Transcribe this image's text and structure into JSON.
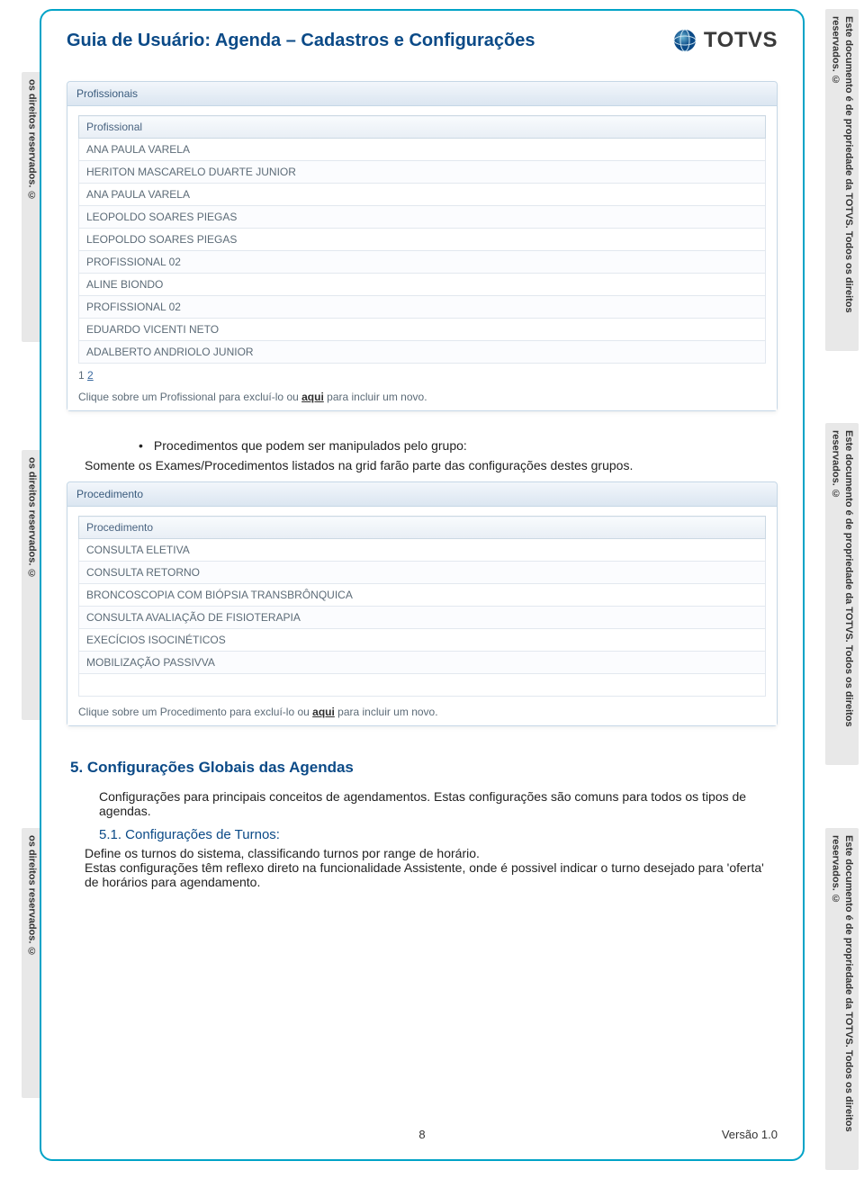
{
  "doc_title": "Guia de Usuário: Agenda – Cadastros e Configurações",
  "brand": "TOTVS",
  "watermark": "Este documento é de propriedade da TOTVS. Todos os direitos reservados. ©",
  "panel1": {
    "title": "Profissionais",
    "header": "Profissional",
    "rows": [
      "ANA PAULA VARELA",
      "HERITON MASCARELO DUARTE JUNIOR",
      "ANA PAULA VARELA",
      "LEOPOLDO SOARES PIEGAS",
      "LEOPOLDO SOARES PIEGAS",
      "PROFISSIONAL 02",
      "ALINE BIONDO",
      "PROFISSIONAL 02",
      "EDUARDO VICENTI NETO",
      "ADALBERTO ANDRIOLO JUNIOR"
    ],
    "pager_pages": [
      "1",
      "2"
    ],
    "hint_pre": "Clique sobre um Profissional para excluí-lo ou  ",
    "hint_link": "aqui",
    "hint_post": "  para incluir um novo."
  },
  "bullet": "Procedimentos que podem ser manipulados pelo grupo:",
  "paragraph1": "Somente os Exames/Procedimentos listados na grid farão parte das configurações destes grupos.",
  "panel2": {
    "title": "Procedimento",
    "header": "Procedimento",
    "rows": [
      "CONSULTA ELETIVA",
      "CONSULTA RETORNO",
      "BRONCOSCOPIA COM BIÓPSIA TRANSBRÔNQUICA",
      "CONSULTA AVALIAÇÃO DE FISIOTERAPIA",
      "EXECÍCIOS ISOCINÉTICOS",
      "MOBILIZAÇÃO PASSIVVA"
    ],
    "hint_pre": "Clique sobre um Procedimento para excluí-lo ou  ",
    "hint_link": "aqui",
    "hint_post": "  para incluir um novo."
  },
  "section5": {
    "heading": "5. Configurações Globais das Agendas",
    "body": "Configurações para principais conceitos de agendamentos. Estas configurações são comuns para todos os tipos de agendas."
  },
  "section5_1": {
    "heading": "5.1. Configurações de Turnos:",
    "body": "Define os turnos do sistema, classificando turnos por range de horário.\nEstas configurações têm reflexo direto na funcionalidade Assistente, onde é possivel indicar o turno desejado para 'oferta' de horários para agendamento."
  },
  "footer": {
    "page_number": "8",
    "version": "Versão 1.0"
  }
}
